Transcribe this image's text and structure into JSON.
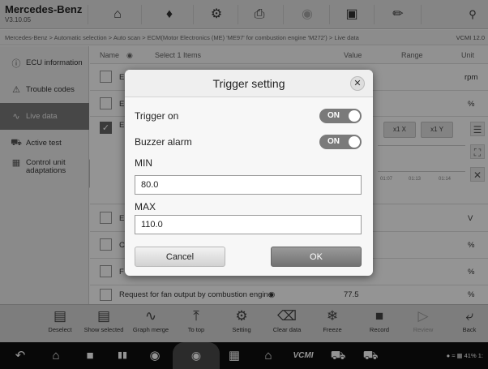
{
  "app": {
    "name": "Mercedes-Benz",
    "version": "V3.10.05"
  },
  "topbar_icons": [
    "home-icon",
    "vehicle-swap-icon",
    "settings-gear-icon",
    "printer-icon",
    "help-icon",
    "save-icon",
    "edit-icon",
    "search-icon"
  ],
  "breadcrumb": {
    "path": "Mercedes-Benz > Automatic selection > Auto scan > ECM(Motor Electronics (ME) 'ME97' for combustion engine 'M272') > Live data",
    "right": "VCMI 12.0"
  },
  "sidebar": {
    "items": [
      {
        "label": "ECU information"
      },
      {
        "label": "Trouble codes"
      },
      {
        "label": "Live data"
      },
      {
        "label": "Active test"
      },
      {
        "label": "Control unit adaptations"
      }
    ]
  },
  "table": {
    "header": {
      "name": "Name",
      "select": "Select 1 Items",
      "value": "Value",
      "range": "Range",
      "unit": "Unit"
    },
    "rows": [
      {
        "name": "E",
        "value": "",
        "unit": "rpm"
      },
      {
        "name": "E",
        "value": "",
        "unit": "%"
      },
      {
        "name": "E",
        "value": "",
        "unit": ""
      },
      {
        "name": "E",
        "value": "",
        "unit": "V"
      },
      {
        "name": "C",
        "value": "",
        "unit": "%"
      },
      {
        "name": "F",
        "value": "",
        "unit": "%"
      },
      {
        "name": "Request for fan output by combustion engine",
        "value": "77.5",
        "unit": "%"
      }
    ],
    "graph": {
      "zoom_x": "x1 X",
      "zoom_y": "x1 Y",
      "ticks": [
        "01:07",
        "01:13",
        "01:14"
      ]
    }
  },
  "dialog": {
    "title": "Trigger setting",
    "trigger_on": {
      "label": "Trigger on",
      "state": "ON"
    },
    "buzzer_alarm": {
      "label": "Buzzer alarm",
      "state": "ON"
    },
    "min": {
      "label": "MIN",
      "value": "80.0"
    },
    "max": {
      "label": "MAX",
      "value": "110.0"
    },
    "cancel_label": "Cancel",
    "ok_label": "OK"
  },
  "toolbar": {
    "items": [
      {
        "label": "Deselect"
      },
      {
        "label": "Show selected"
      },
      {
        "label": "Graph merge"
      },
      {
        "label": "To top"
      },
      {
        "label": "Setting"
      },
      {
        "label": "Clear data"
      },
      {
        "label": "Freeze"
      },
      {
        "label": "Record"
      },
      {
        "label": "Review"
      },
      {
        "label": "Back"
      }
    ]
  },
  "status_bar": {
    "right": "41%  1:"
  },
  "colors": {
    "toggle_on": "#7a7a7a",
    "active_sidebar": "#7a7a7a",
    "ok_button": "#808080"
  }
}
